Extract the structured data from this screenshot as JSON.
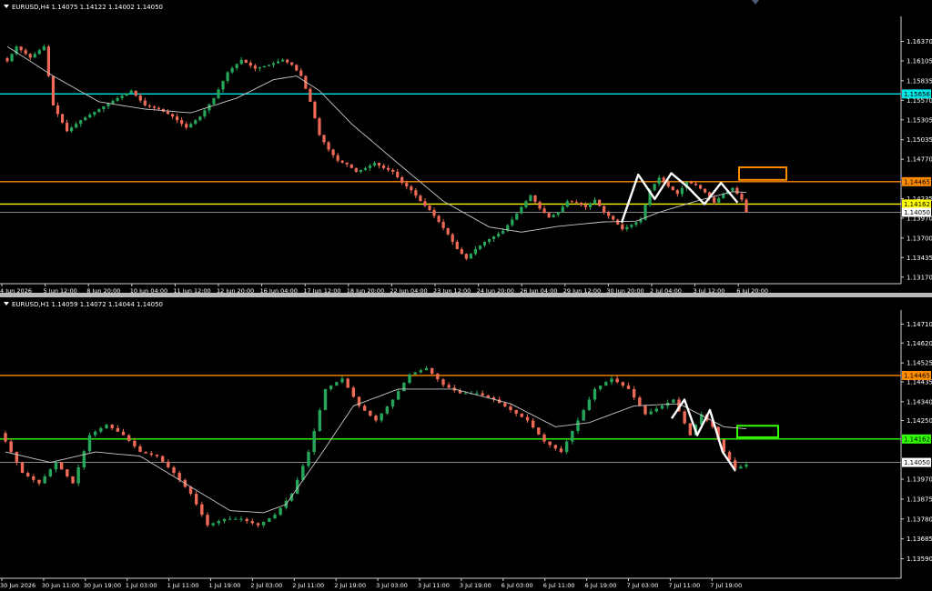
{
  "chart_data": [
    {
      "type": "candlestick",
      "title": "EURUSD,H4  1.14075 1.14122 1.14002 1.14050",
      "ylim": [
        1.1313,
        1.1666
      ],
      "price_ticks": [
        "1.16370",
        "1.16105",
        "1.15835",
        "1.15570",
        "1.15305",
        "1.15035",
        "1.14770",
        "1.14235",
        "1.13970",
        "1.13700",
        "1.13435",
        "1.13170"
      ],
      "time_ticks": [
        "4 Jun 2026",
        "5 Jun 12:00",
        "8 Jun 20:00",
        "10 Jun 04:00",
        "11 Jun 12:00",
        "12 Jun 20:00",
        "16 Jun 04:00",
        "17 Jun 12:00",
        "18 Jun 20:00",
        "22 Jun 04:00",
        "23 Jun 12:00",
        "24 Jun 20:00",
        "26 Jun 04:00",
        "29 Jun 12:00",
        "30 Jun 20:00",
        "2 Jul 04:00",
        "3 Jul 12:00",
        "6 Jul 20:00"
      ],
      "hlines": [
        {
          "label": "1.15656",
          "price": 1.15656,
          "color": "#00e5e5"
        },
        {
          "label": "1.14465",
          "price": 1.14465,
          "color": "#ff8c00"
        },
        {
          "label": "1.14162",
          "price": 1.14162,
          "color": "#ffff00"
        },
        {
          "label": "1.14050",
          "price": 1.1405,
          "color": "#9a9a9a"
        }
      ],
      "zone": {
        "price_low": 1.1449,
        "price_high": 1.1466,
        "color": "#ff8c00"
      },
      "pattern": [
        1.1391,
        1.1456,
        1.1423,
        1.1458,
        1.1439,
        1.1416,
        1.1445,
        1.1418
      ],
      "colors": {
        "bull": "#26a65b",
        "bear": "#ef6a57",
        "ma": "#c8c8c8"
      },
      "anchors": [
        [
          0,
          1.161
        ],
        [
          2,
          1.163
        ],
        [
          5,
          1.1615
        ],
        [
          8,
          1.163
        ],
        [
          10,
          1.155
        ],
        [
          13,
          1.1515
        ],
        [
          16,
          1.153
        ],
        [
          20,
          1.1545
        ],
        [
          24,
          1.156
        ],
        [
          27,
          1.157
        ],
        [
          30,
          1.155
        ],
        [
          33,
          1.1545
        ],
        [
          36,
          1.1535
        ],
        [
          39,
          1.152
        ],
        [
          42,
          1.1535
        ],
        [
          45,
          1.156
        ],
        [
          48,
          1.1595
        ],
        [
          51,
          1.1612
        ],
        [
          54,
          1.16
        ],
        [
          57,
          1.1605
        ],
        [
          60,
          1.1612
        ],
        [
          62,
          1.1605
        ],
        [
          64,
          1.159
        ],
        [
          66,
          1.1555
        ],
        [
          68,
          1.151
        ],
        [
          70,
          1.149
        ],
        [
          72,
          1.1475
        ],
        [
          74,
          1.147
        ],
        [
          76,
          1.146
        ],
        [
          78,
          1.1465
        ],
        [
          80,
          1.1472
        ],
        [
          82,
          1.1465
        ],
        [
          84,
          1.146
        ],
        [
          86,
          1.1445
        ],
        [
          88,
          1.1435
        ],
        [
          90,
          1.142
        ],
        [
          92,
          1.1408
        ],
        [
          94,
          1.1392
        ],
        [
          96,
          1.1375
        ],
        [
          98,
          1.1355
        ],
        [
          100,
          1.1342
        ],
        [
          102,
          1.1355
        ],
        [
          104,
          1.1365
        ],
        [
          106,
          1.1372
        ],
        [
          108,
          1.138
        ],
        [
          110,
          1.1395
        ],
        [
          112,
          1.1412
        ],
        [
          114,
          1.1428
        ],
        [
          116,
          1.141
        ],
        [
          118,
          1.1398
        ],
        [
          120,
          1.1405
        ],
        [
          122,
          1.142
        ],
        [
          124,
          1.1418
        ],
        [
          126,
          1.1412
        ],
        [
          128,
          1.1422
        ],
        [
          130,
          1.1405
        ],
        [
          132,
          1.1395
        ],
        [
          134,
          1.1382
        ],
        [
          136,
          1.1388
        ],
        [
          138,
          1.1395
        ],
        [
          140,
          1.1435
        ],
        [
          142,
          1.1452
        ],
        [
          144,
          1.144
        ],
        [
          146,
          1.143
        ],
        [
          148,
          1.1446
        ],
        [
          150,
          1.1442
        ],
        [
          152,
          1.1432
        ],
        [
          154,
          1.1418
        ],
        [
          156,
          1.143
        ],
        [
          158,
          1.1438
        ],
        [
          160,
          1.1422
        ],
        [
          161,
          1.1405
        ]
      ],
      "ma_anchors": [
        [
          0,
          1.163
        ],
        [
          10,
          1.159
        ],
        [
          20,
          1.1555
        ],
        [
          30,
          1.1545
        ],
        [
          40,
          1.154
        ],
        [
          50,
          1.156
        ],
        [
          58,
          1.1585
        ],
        [
          63,
          1.159
        ],
        [
          68,
          1.157
        ],
        [
          75,
          1.1525
        ],
        [
          85,
          1.1472
        ],
        [
          95,
          1.142
        ],
        [
          105,
          1.1385
        ],
        [
          112,
          1.1378
        ],
        [
          120,
          1.1386
        ],
        [
          130,
          1.1392
        ],
        [
          137,
          1.1393
        ],
        [
          142,
          1.1405
        ],
        [
          150,
          1.142
        ],
        [
          158,
          1.1433
        ],
        [
          161,
          1.1432
        ]
      ]
    },
    {
      "type": "candlestick",
      "title": "EURUSD,H1  1.14059 1.14072 1.14044 1.14050",
      "ylim": [
        1.1351,
        1.1476
      ],
      "price_ticks": [
        "1.14710",
        "1.14620",
        "1.14525",
        "1.14435",
        "1.14340",
        "1.14250",
        "1.13970",
        "1.13875",
        "1.13780",
        "1.13685",
        "1.13590"
      ],
      "time_ticks": [
        "30 Jun 2026",
        "30 Jun 11:00",
        "30 Jun 19:00",
        "1 Jul 03:00",
        "1 Jul 11:00",
        "1 Jul 19:00",
        "2 Jul 03:00",
        "2 Jul 11:00",
        "2 Jul 19:00",
        "3 Jul 03:00",
        "3 Jul 11:00",
        "3 Jul 19:00",
        "6 Jul 03:00",
        "6 Jul 11:00",
        "6 Jul 19:00",
        "7 Jul 03:00",
        "7 Jul 11:00",
        "7 Jul 19:00"
      ],
      "hlines": [
        {
          "label": "1.14465",
          "price": 1.14465,
          "color": "#ff8c00"
        },
        {
          "label": "1.14162",
          "price": 1.14162,
          "color": "#33ff00"
        },
        {
          "label": "1.14050",
          "price": 1.1405,
          "color": "#9a9a9a"
        }
      ],
      "zone": {
        "price_low": 1.1417,
        "price_high": 1.14225,
        "color": "#33ff00"
      },
      "pattern": [
        1.1426,
        1.1435,
        1.1418,
        1.143,
        1.141,
        1.1401
      ],
      "colors": {
        "bull": "#26a65b",
        "bear": "#ef6a57",
        "ma": "#c8c8c8"
      },
      "anchors": [
        [
          0,
          1.1415
        ],
        [
          3,
          1.14
        ],
        [
          6,
          1.1395
        ],
        [
          9,
          1.1405
        ],
        [
          12,
          1.1395
        ],
        [
          15,
          1.1418
        ],
        [
          18,
          1.1423
        ],
        [
          21,
          1.1418
        ],
        [
          24,
          1.141
        ],
        [
          27,
          1.1408
        ],
        [
          30,
          1.14
        ],
        [
          33,
          1.139
        ],
        [
          36,
          1.1375
        ],
        [
          39,
          1.1378
        ],
        [
          42,
          1.1378
        ],
        [
          45,
          1.1375
        ],
        [
          48,
          1.138
        ],
        [
          51,
          1.139
        ],
        [
          54,
          1.141
        ],
        [
          57,
          1.144
        ],
        [
          60,
          1.1445
        ],
        [
          63,
          1.1432
        ],
        [
          66,
          1.1425
        ],
        [
          69,
          1.1435
        ],
        [
          72,
          1.1447
        ],
        [
          75,
          1.145
        ],
        [
          78,
          1.1442
        ],
        [
          81,
          1.1438
        ],
        [
          84,
          1.1438
        ],
        [
          87,
          1.1435
        ],
        [
          90,
          1.143
        ],
        [
          93,
          1.1425
        ],
        [
          96,
          1.1415
        ],
        [
          99,
          1.141
        ],
        [
          102,
          1.1425
        ],
        [
          105,
          1.144
        ],
        [
          108,
          1.1445
        ],
        [
          111,
          1.144
        ],
        [
          114,
          1.1428
        ],
        [
          117,
          1.1432
        ],
        [
          119,
          1.1435
        ],
        [
          122,
          1.1418
        ],
        [
          124,
          1.1428
        ],
        [
          126,
          1.1422
        ],
        [
          128,
          1.141
        ],
        [
          130,
          1.1402
        ],
        [
          132,
          1.1404
        ]
      ],
      "ma_anchors": [
        [
          0,
          1.141
        ],
        [
          8,
          1.1405
        ],
        [
          16,
          1.141
        ],
        [
          24,
          1.1408
        ],
        [
          32,
          1.1395
        ],
        [
          40,
          1.1382
        ],
        [
          46,
          1.1381
        ],
        [
          50,
          1.1385
        ],
        [
          56,
          1.1408
        ],
        [
          62,
          1.1432
        ],
        [
          70,
          1.144
        ],
        [
          80,
          1.144
        ],
        [
          90,
          1.1433
        ],
        [
          98,
          1.1422
        ],
        [
          104,
          1.1424
        ],
        [
          112,
          1.1432
        ],
        [
          120,
          1.1433
        ],
        [
          128,
          1.1422
        ],
        [
          132,
          1.1421
        ]
      ]
    }
  ]
}
